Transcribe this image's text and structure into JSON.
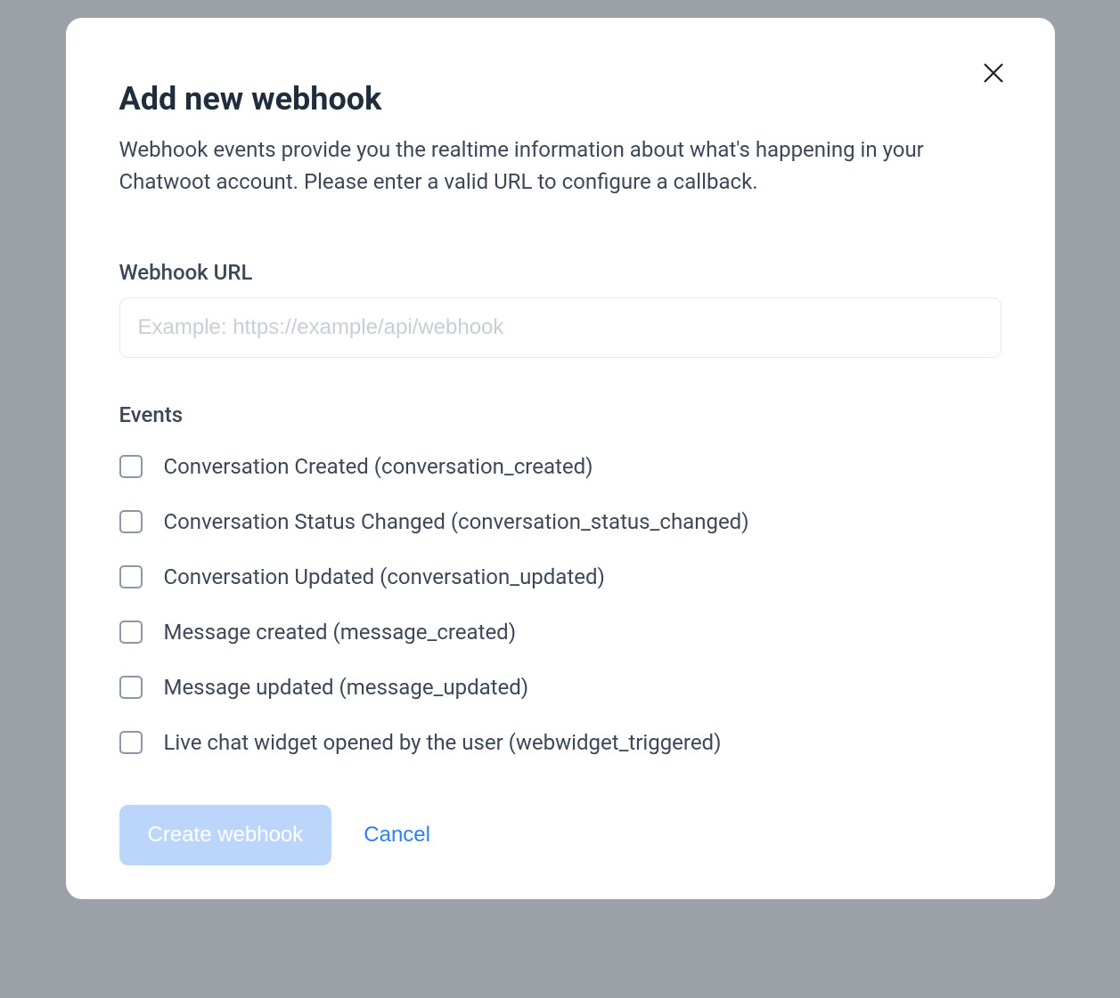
{
  "modal": {
    "title": "Add new webhook",
    "description": "Webhook events provide you the realtime information about what's happening in your Chatwoot account. Please enter a valid URL to configure a callback.",
    "close_icon": "close"
  },
  "form": {
    "url_label": "Webhook URL",
    "url_placeholder": "Example: https://example/api/webhook",
    "url_value": "",
    "events_label": "Events",
    "events": [
      {
        "label": "Conversation Created (conversation_created)",
        "checked": false
      },
      {
        "label": "Conversation Status Changed (conversation_status_changed)",
        "checked": false
      },
      {
        "label": "Conversation Updated (conversation_updated)",
        "checked": false
      },
      {
        "label": "Message created (message_created)",
        "checked": false
      },
      {
        "label": "Message updated (message_updated)",
        "checked": false
      },
      {
        "label": "Live chat widget opened by the user (webwidget_triggered)",
        "checked": false
      }
    ]
  },
  "actions": {
    "submit_label": "Create webhook",
    "cancel_label": "Cancel"
  }
}
